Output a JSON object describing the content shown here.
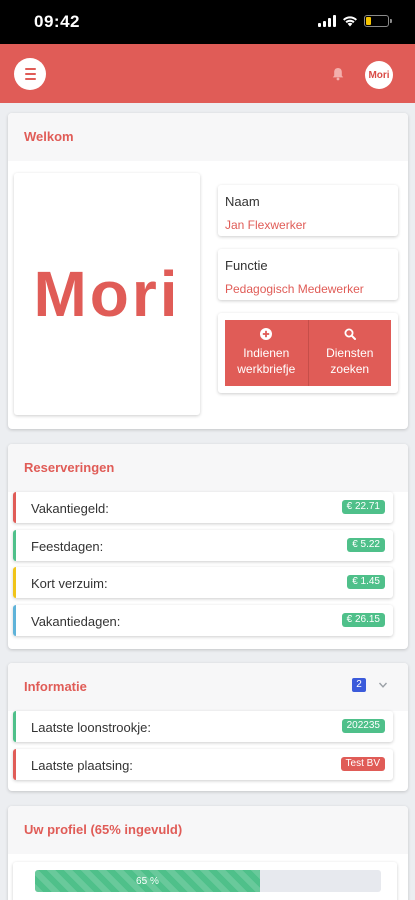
{
  "status_bar": {
    "time": "09:42"
  },
  "app": {
    "avatar_text": "Mori",
    "logo_text": "Mori"
  },
  "colors": {
    "brand": "#e05c57",
    "green": "#4fc08a",
    "yellow": "#f0c419",
    "blue": "#5fb3d9",
    "navy_badge": "#3b5bdb"
  },
  "welcome": {
    "title": "Welkom",
    "name_label": "Naam",
    "name_value": "Jan Flexwerker",
    "function_label": "Functie",
    "function_value": "Pedagogisch Medewerker",
    "action1_line1": "Indienen",
    "action1_line2": "werkbriefje",
    "action1_icon": "plus-circle-icon",
    "action2_line1": "Diensten",
    "action2_line2": "zoeken",
    "action2_icon": "search-icon"
  },
  "reserveringen": {
    "title": "Reserveringen",
    "items": [
      {
        "label": "Vakantiegeld:",
        "value": "€ 22.71",
        "edge_color": "#e05c57"
      },
      {
        "label": "Feestdagen:",
        "value": "€ 5.22",
        "edge_color": "#4fc08a"
      },
      {
        "label": "Kort verzuim:",
        "value": "€ 1.45",
        "edge_color": "#f0c419"
      },
      {
        "label": "Vakantiedagen:",
        "value": "€ 26.15",
        "edge_color": "#5fb3d9"
      }
    ]
  },
  "informatie": {
    "title": "Informatie",
    "count": "2",
    "items": [
      {
        "label": "Laatste loonstrookje:",
        "value": "202235",
        "badge_color": "#4fc08a",
        "edge_color": "#4fc08a"
      },
      {
        "label": "Laatste plaatsing:",
        "value": "Test BV",
        "badge_color": "#e05c57",
        "edge_color": "#e05c57"
      }
    ]
  },
  "profiel": {
    "title": "Uw profiel (65% ingevuld)",
    "progress_label": "65 %",
    "progress": 0.65
  }
}
